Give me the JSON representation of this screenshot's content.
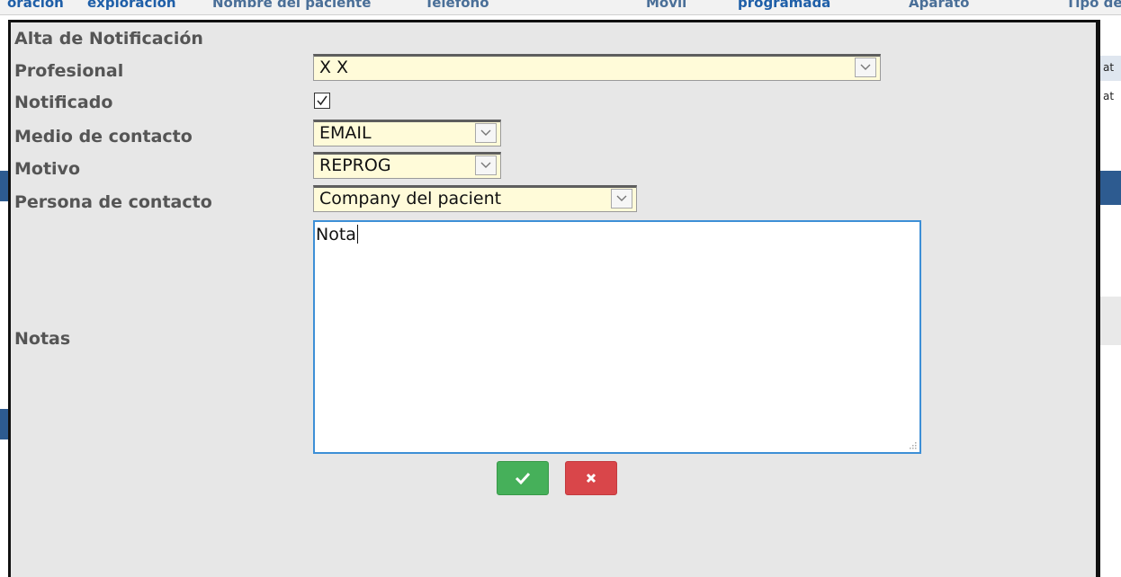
{
  "background": {
    "header_cols": [
      "oración",
      "exploración",
      "Nombre del paciente",
      "Teléfono",
      "Móvil",
      "programada",
      "Aparato",
      "Tipo de"
    ],
    "right_texts": [
      "at",
      "at"
    ]
  },
  "modal": {
    "title": "Alta de Notificación",
    "fields": {
      "profesional": {
        "label": "Profesional",
        "value": "X X"
      },
      "notificado": {
        "label": "Notificado",
        "checked": true
      },
      "medio_contacto": {
        "label": "Medio de contacto",
        "value": "EMAIL"
      },
      "motivo": {
        "label": "Motivo",
        "value": "REPROG"
      },
      "persona_contacto": {
        "label": "Persona de contacto",
        "value": "Company del pacient"
      },
      "notas": {
        "label": "Notas",
        "value": "Nota"
      }
    },
    "buttons": {
      "confirm_icon": "check-icon",
      "cancel_icon": "close-icon"
    }
  },
  "colors": {
    "select_bg": "#fffbd9",
    "confirm": "#46b05a",
    "cancel": "#d9464a",
    "focus_border": "#3d8fd6"
  }
}
